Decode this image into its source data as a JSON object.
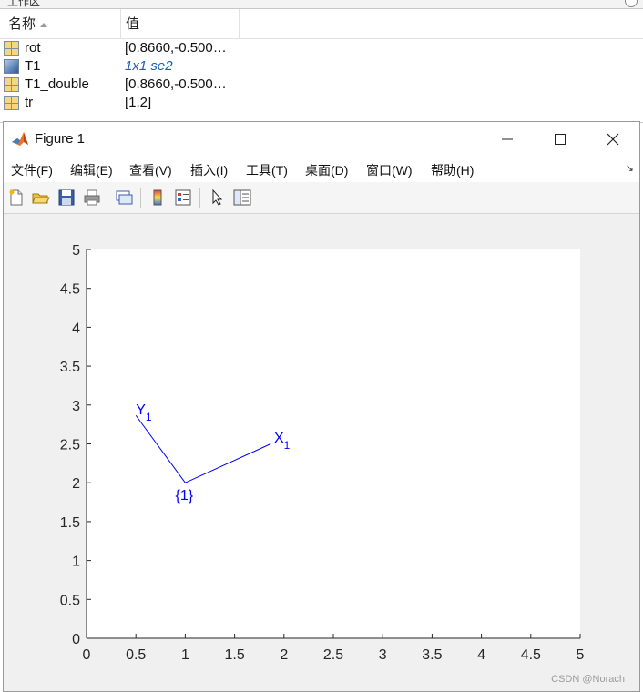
{
  "workspace": {
    "title": "工作区",
    "columns": {
      "name": "名称",
      "value": "值"
    },
    "variables": [
      {
        "name": "rot",
        "value": "[0.8660,-0.500…",
        "icon": "matrix-icon",
        "is_object": false
      },
      {
        "name": "T1",
        "value": "1x1 se2",
        "icon": "object-icon",
        "is_object": true
      },
      {
        "name": "T1_double",
        "value": "[0.8660,-0.500…",
        "icon": "matrix-icon",
        "is_object": false
      },
      {
        "name": "tr",
        "value": "[1,2]",
        "icon": "matrix-icon",
        "is_object": false
      }
    ]
  },
  "figure": {
    "title": "Figure 1",
    "window_buttons": {
      "minimize": "minimize-icon",
      "maximize": "maximize-icon",
      "close": "close-icon"
    },
    "menu": [
      "文件(F)",
      "编辑(E)",
      "查看(V)",
      "插入(I)",
      "工具(T)",
      "桌面(D)",
      "窗口(W)",
      "帮助(H)"
    ],
    "menu_overflow_icon": "↘",
    "toolbar": [
      "new-figure-icon",
      "open-file-icon",
      "save-icon",
      "print-icon",
      "link-plot-icon",
      "insert-colorbar-icon",
      "insert-legend-icon",
      "edit-plot-pointer-icon",
      "property-inspector-icon"
    ]
  },
  "chart_data": {
    "type": "line",
    "title": "",
    "xlabel": "",
    "ylabel": "",
    "xlim": [
      0,
      5
    ],
    "ylim": [
      0,
      5
    ],
    "xticks": [
      "0",
      "0.5",
      "1",
      "1.5",
      "2",
      "2.5",
      "3",
      "3.5",
      "4",
      "4.5",
      "5"
    ],
    "yticks": [
      "0",
      "0.5",
      "1",
      "1.5",
      "2",
      "2.5",
      "3",
      "3.5",
      "4",
      "4.5",
      "5"
    ],
    "grid": false,
    "series": [
      {
        "x": [
          1,
          1.866
        ],
        "y": [
          2,
          2.5
        ],
        "color": "#0000ff"
      },
      {
        "x": [
          1,
          0.5
        ],
        "y": [
          2,
          2.866
        ],
        "color": "#0000ff"
      }
    ],
    "annotations": [
      {
        "text": "{1}",
        "x": 0.9,
        "y": 1.78
      },
      {
        "text": "X",
        "sub": "1",
        "x": 1.9,
        "y": 2.52
      },
      {
        "text": "Y",
        "sub": "1",
        "x": 0.5,
        "y": 2.88
      }
    ],
    "colors": {
      "frame": "#0000ff",
      "axes_bg": "#ffffff",
      "figure_bg": "#f0f0f0"
    }
  },
  "watermark": "CSDN @Norach"
}
